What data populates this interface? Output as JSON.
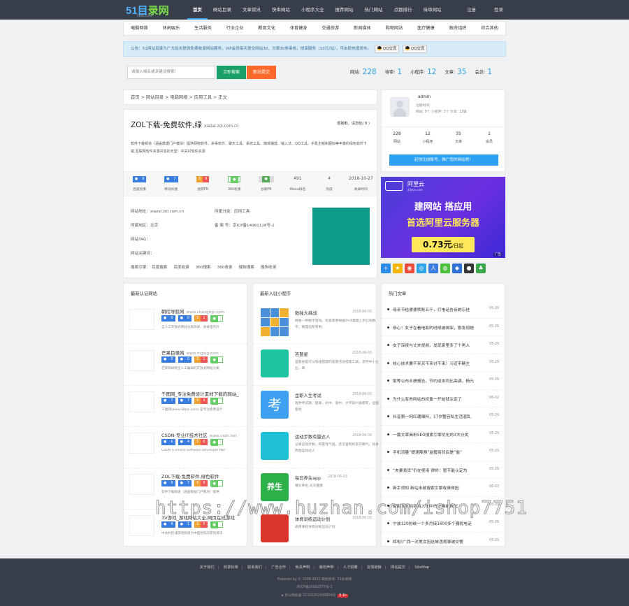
{
  "logo": {
    "text_a": "51目",
    "text_b": "录网",
    "sub": "51ML.COM"
  },
  "topnav": [
    "首页",
    "网站目录",
    "文章资讯",
    "快审网站",
    "小程序大全",
    "推荐网站",
    "热门网站",
    "点题排行",
    "待审网站"
  ],
  "toplinks": [
    "注册",
    "登录"
  ],
  "categories": [
    "电脑网络",
    "休闲娱乐",
    "生活服务",
    "行业企业",
    "教育文化",
    "体育健身",
    "交通旅游",
    "新闻媒体",
    "购物网站",
    "医疗健康",
    "政府组织",
    "综合其他"
  ],
  "notice": {
    "text": "公告：51网站目录为广大站长提供免费收录网站服务，VIP会员每天提交网站30、文章30条审核，快审服务（10元/站），可自助充值发布。",
    "qq1": "QQ交流",
    "qq2": "QQ交流"
  },
  "search": {
    "placeholder": "请输入域名或关键词搜索！",
    "search_btn": "立即搜索",
    "submit_btn": "新站提交"
  },
  "stats": [
    {
      "label": "网站:",
      "value": "228"
    },
    {
      "label": "待审:",
      "value": "1"
    },
    {
      "label": "小程序:",
      "value": "12"
    },
    {
      "label": "文章:",
      "value": "35"
    },
    {
      "label": "会员:",
      "value": "1"
    }
  ],
  "breadcrumb": "首页 > 网站目录 > 电脑网络 > 应用工具 > 正文",
  "site": {
    "title": "ZOL下载-免费软件,绿",
    "domain": "xiazai.zol.com.cn",
    "rating": "很抱歉，请您给( 8 )",
    "desc": "软件下载频道（涵盖数据门户模块）提供网络软件、杀毒软件、聊天工具、系统工具、媒体播放、输入法、QQ工具、手机主题和图标等丰富的绿色软件下载,互联网软件资源共享的天堂！中关村软件资源",
    "metrics": [
      {
        "k": "百度权重",
        "v": "9",
        "type": "baidu"
      },
      {
        "k": "移动权重",
        "v": "7",
        "type": "mobile"
      },
      {
        "k": "搜狗PR",
        "v": "9",
        "type": "sogou"
      },
      {
        "k": "360权重",
        "v": "",
        "type": "s360"
      },
      {
        "k": "谷歌PR",
        "v": "",
        "type": "google"
      },
      {
        "k": "Alexa排名",
        "v": "491",
        "type": "text"
      },
      {
        "k": "热度",
        "v": "4",
        "type": "text"
      },
      {
        "k": "收录时间",
        "v": "2018-10-27",
        "type": "text"
      }
    ],
    "address_label": "网站地址：",
    "address": "xiazai.zol.com.cn",
    "cat_label": "所属分类：",
    "cat": "应用工具",
    "region_label": "所属地区：",
    "region": "北京",
    "icp_label": "备 案 号：",
    "icp": "京ICP备14061128号-2",
    "tag_label": "网站TAG：",
    "kw_label": "网站关键词：",
    "engine_label": "搜索引擎：",
    "engines": [
      "百度搜索",
      "百度收录",
      "360搜索",
      "360收录",
      "搜狗搜索",
      "搜狗收录"
    ]
  },
  "user": {
    "name": "admin",
    "sub": "注册时间:",
    "counts": "网站: 0个  小程序: 3个  文章: 12篇",
    "stats": [
      {
        "n": "228",
        "t": "网站"
      },
      {
        "n": "12",
        "t": "小程序"
      },
      {
        "n": "35",
        "t": "文章"
      },
      {
        "n": "1",
        "t": "会员"
      }
    ],
    "register_btn": "赶快注册账号，推广您的网站吧！"
  },
  "ad": {
    "brand": "阿里云",
    "brand_sub": "aliyun.com",
    "line1": "建网站 搭应用",
    "line2": "首选阿里云服务器",
    "price": "0.73元",
    "unit": "/日起",
    "tag": "广告"
  },
  "latest_sites": {
    "title": "最新认证网站",
    "items": [
      {
        "name": "朝衔导航网",
        "domain": "www.chaogmp.com",
        "b1": "0",
        "b2": "0",
        "b3": "1",
        "desc": "全人工开放式网站分类目录，收录国内外"
      },
      {
        "name": "芒果目录网",
        "domain": "www.mgojg.com",
        "b1": "0",
        "b2": "0",
        "b3": "1",
        "desc": "芒果目录网全人工编辑的开放式网站分类"
      },
      {
        "name": "千图网_专注免费设计素材下载的网站_",
        "domain": "",
        "b1": "7",
        "b2": "7",
        "b3": "4",
        "desc": "千图网(www.58pic.com) 是专注免费设计"
      },
      {
        "name": "CSDN-专业IT技术社区",
        "domain": "www.csdn.net",
        "b1": "6",
        "b2": "4",
        "b3": "6",
        "desc": "CSDN (Chinese Software Developer Net"
      },
      {
        "name": "ZOL下载-免费软件,绿色软件",
        "domain": "",
        "b1": "9",
        "b2": "7",
        "b3": "9",
        "desc": "软件下载频道（涵盖数据门户模块）提供"
      },
      {
        "name": "3V游戏_游戏网站大全,网页在线游戏",
        "domain": "",
        "b1": "4",
        "b2": "1",
        "b3": "5",
        "desc": "中关村在线游戏频道为中国领先的游戏资讯"
      }
    ]
  },
  "latest_apps": {
    "title": "最新入驻小程序",
    "items": [
      {
        "name": "数独大挑战",
        "date": "2018-06-03",
        "desc": "数独一种数字游戏。玩家需要根据9×9盘面上的已知数字，推理出所有剩",
        "icon": "sudoku"
      },
      {
        "name": "答题星",
        "date": "2018-06-03",
        "desc": "答题星是可以快速搭建的答题活动搭建工具，支持中小企业、政",
        "icon": "answer"
      },
      {
        "name": "金职人生考试",
        "date": "2018-06-03",
        "desc": "各种考试题、题库、初中、高中、大学四六级都有，全国各地",
        "icon": "exam"
      },
      {
        "name": "运动步数有量达人",
        "date": "2018-06-03",
        "desc": "记录运动步数、积累有气值。还可喜和好友的朝气。找身周围运动达人",
        "icon": "run"
      },
      {
        "name": "每日养生app",
        "date": "2018-06-03",
        "desc": "每日养生,天天健康",
        "icon": "health"
      },
      {
        "name": "体育训练运动计划",
        "date": "2018-06-03",
        "desc": "通用课程体育训练运动计划",
        "icon": "sport"
      }
    ]
  },
  "hot_articles": {
    "title": "热门文章",
    "items": [
      {
        "t": "母亲节给婆婆转账五千，打电话告诉她忘挂",
        "d": "05-29"
      },
      {
        "t": "恭心！女子在看电影的时候被绑架，刚发现她",
        "d": "05-29"
      },
      {
        "t": "女子深夜与丈夫视频，发现家里多了个男人",
        "d": "05-29"
      },
      {
        "t": "核心技术要不来买不来讨不来！习近平精主",
        "d": "05-29"
      },
      {
        "t": "取等公布业绩报告，节约成本同比高调，杨元",
        "d": "05-29"
      },
      {
        "t": "为什么有些网站的权重一开始就注定了",
        "d": "06-02"
      },
      {
        "t": "抖音第一网红遭曝料，17岁整容私生活混乱",
        "d": "05-29"
      },
      {
        "t": "一篇文章简析SEO搜索引擎优化的3大分类",
        "d": "05-29"
      },
      {
        "t": "手机流量“提速降费”监管商背后是“偷”",
        "d": "05-29"
      },
      {
        "t": "“夫妻卖货”仍在使用 律师：暂不能认定为",
        "d": "05-29"
      },
      {
        "t": "新手须知 新站未被搜索引擎收录原因",
        "d": "06-03"
      },
      {
        "t": "摄影师抓拍到陷入水中的小猫被救起",
        "d": "05-29"
      },
      {
        "t": "宁波120协统一个多月接1600多个骚扰电话",
        "d": "05-29"
      },
      {
        "t": "辉啦!广西一对男女因这故违规事被交警",
        "d": "05-29"
      }
    ]
  },
  "footer": {
    "links": [
      "关于我们",
      "收录标准",
      "联系我们",
      "广告合作",
      "免责声明",
      "版权声明",
      "人才招聘",
      "友情链接",
      "网站提交",
      "SiteMap"
    ],
    "copy": "Powered by © 2008-2021 版权所有: 51目录网",
    "icp": "京ICP备10002577号-3",
    "police": "京公网安备 32320302000809号",
    "badge": "5.1k"
  },
  "watermark": "https://www.huzhan.com/ishop7751"
}
